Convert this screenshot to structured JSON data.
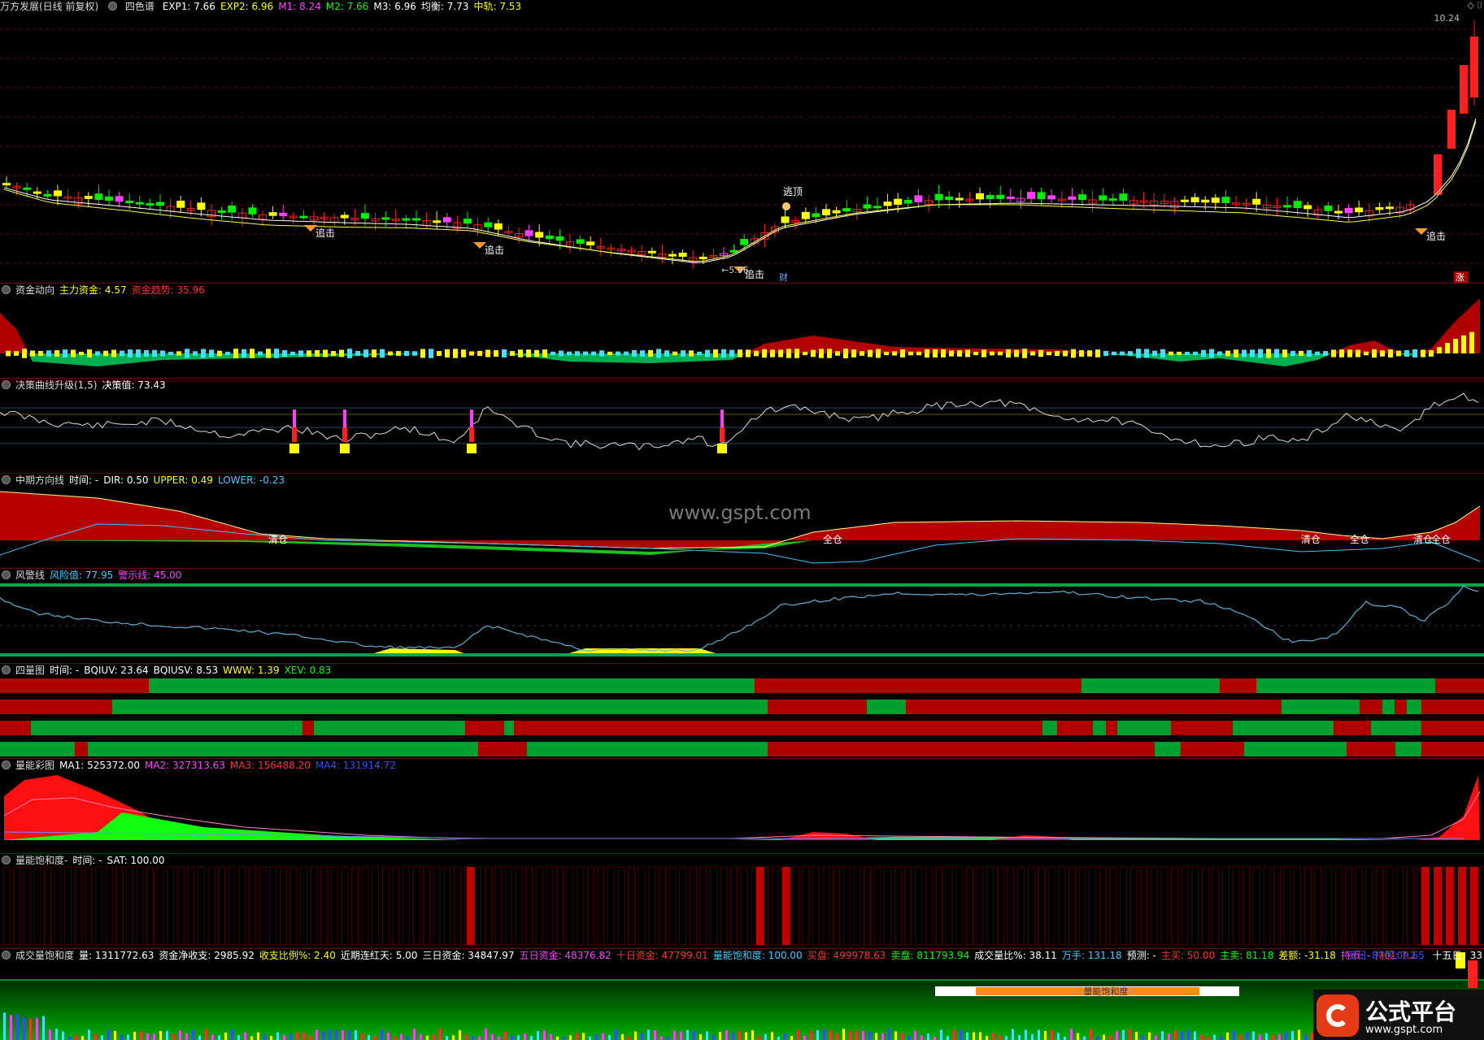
{
  "main": {
    "title": "万方发展(日线 前复权)",
    "indicator": "四色谱",
    "fields": [
      {
        "label": "EXP1:",
        "value": "7.66",
        "color": "#ffffff"
      },
      {
        "label": "EXP2:",
        "value": "6.96",
        "color": "#ffff00"
      },
      {
        "label": "M1:",
        "value": "8.24",
        "color": "#ff40ff"
      },
      {
        "label": "M2:",
        "value": "7.66",
        "color": "#00ff00"
      },
      {
        "label": "M3:",
        "value": "6.96",
        "color": "#ffffff"
      },
      {
        "label": "均衡:",
        "value": "7.73",
        "color": "#ffffff"
      },
      {
        "label": "中轨:",
        "value": "7.53",
        "color": "#ffff00"
      }
    ],
    "price_high_label": "10.24",
    "low_label": "←5.96",
    "annotations": {
      "chase": "追击",
      "escape": "逃顶",
      "cai": "财",
      "zhang": "涨"
    }
  },
  "p1": {
    "title": "资金动向",
    "items": [
      {
        "label": "主力资金:",
        "value": "4.57",
        "color": "#ffff00"
      },
      {
        "label": "资金趋势:",
        "value": "35.96",
        "color": "#ff3030"
      }
    ]
  },
  "p2": {
    "title": "决策曲线升级(1,5)",
    "items": [
      {
        "label": "决策值:",
        "value": "73.43",
        "color": "#ffffff"
      }
    ]
  },
  "p3": {
    "title": "中期方向线",
    "items": [
      {
        "label": "时间:",
        "value": "-",
        "color": "#ffffff"
      },
      {
        "label": "DIR:",
        "value": "0.50",
        "color": "#ffffff"
      },
      {
        "label": "UPPER:",
        "value": "0.49",
        "color": "#ffff00"
      },
      {
        "label": "LOWER:",
        "value": "-0.23",
        "color": "#44ccff"
      }
    ],
    "tags": {
      "clear": "清仓",
      "full": "全仓"
    }
  },
  "p4": {
    "title": "风警线",
    "items": [
      {
        "label": "风险值:",
        "value": "77.95",
        "color": "#44ccff"
      },
      {
        "label": "警示线:",
        "value": "45.00",
        "color": "#ff40ff"
      }
    ]
  },
  "p5": {
    "title": "四量图",
    "items": [
      {
        "label": "时间:",
        "value": "-",
        "color": "#ffffff"
      },
      {
        "label": "BQIUV:",
        "value": "23.64",
        "color": "#ffffff"
      },
      {
        "label": "BQIUSV:",
        "value": "8.53",
        "color": "#ffffff"
      },
      {
        "label": "WWW:",
        "value": "1.39",
        "color": "#ffff00"
      },
      {
        "label": "XEV:",
        "value": "0.83",
        "color": "#00ff00"
      }
    ]
  },
  "p6": {
    "title": "量能彩图",
    "items": [
      {
        "label": "MA1:",
        "value": "525372.00",
        "color": "#ffffff"
      },
      {
        "label": "MA2:",
        "value": "327313.63",
        "color": "#ff40ff"
      },
      {
        "label": "MA3:",
        "value": "156488.20",
        "color": "#ff3030"
      },
      {
        "label": "MA4:",
        "value": "131914.72",
        "color": "#3050ff"
      }
    ]
  },
  "p7": {
    "title": "量能饱和度-",
    "items": [
      {
        "label": "时间:",
        "value": "-",
        "color": "#ffffff"
      },
      {
        "label": "SAT:",
        "value": "100.00",
        "color": "#ffffff"
      }
    ]
  },
  "p8": {
    "title": "成交量饱和度",
    "items": [
      {
        "label": "量:",
        "value": "1311772.63",
        "color": "#ffffff"
      },
      {
        "label": "资金净收支:",
        "value": "2985.92",
        "color": "#ffffff"
      },
      {
        "label": "收支比例%:",
        "value": "2.40",
        "color": "#ffff00"
      },
      {
        "label": "近期连红天:",
        "value": "5.00",
        "color": "#ffffff"
      },
      {
        "label": "三日资金:",
        "value": "34847.97",
        "color": "#ffffff"
      },
      {
        "label": "五日资金:",
        "value": "48376.82",
        "color": "#ff40ff"
      },
      {
        "label": "十日资金:",
        "value": "47799.01",
        "color": "#ff3030"
      },
      {
        "label": "量能饱和度:",
        "value": "100.00",
        "color": "#44ccff"
      },
      {
        "label": "买盘:",
        "value": "499978.63",
        "color": "#ff3030"
      },
      {
        "label": "卖盘:",
        "value": "811793.94",
        "color": "#00ff00"
      },
      {
        "label": "成交量比%:",
        "value": "38.11",
        "color": "#ffffff"
      },
      {
        "label": "万手:",
        "value": "131.18",
        "color": "#44ccff"
      },
      {
        "label": "预测:",
        "value": "-",
        "color": "#ffffff"
      },
      {
        "label": "主买:",
        "value": "50.00",
        "color": "#ff3030"
      },
      {
        "label": "主卖:",
        "value": "81.18",
        "color": "#00ff00"
      },
      {
        "label": "差额:",
        "value": "-31.18",
        "color": "#ffff00"
      },
      {
        "label": "持币:",
        "value": "-",
        "color": "#ff40ff"
      },
      {
        "label": "持股:",
        "value": "7.23",
        "color": "#ff3030"
      }
    ],
    "right": {
      "label1": "五日",
      "value1": "870109.65",
      "label2": "十五日:",
      "value2": "33"
    },
    "sat_label": "量能饱和度"
  },
  "watermark": "www.gspt.com",
  "logo": {
    "name": "公式平台",
    "url": "www.gspt.com"
  }
}
